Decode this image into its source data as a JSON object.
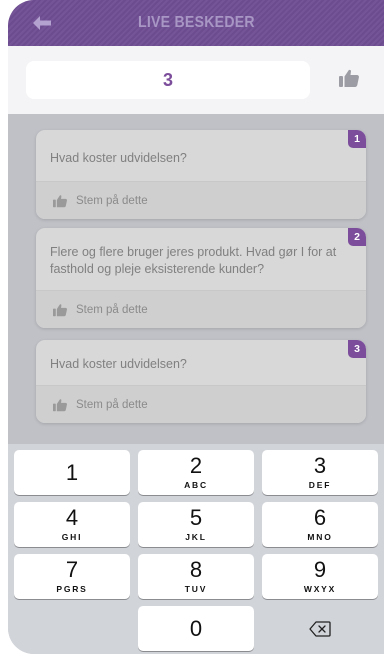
{
  "header": {
    "title": "LIVE BESKEDER",
    "back_icon": "arrow-left-icon"
  },
  "input": {
    "value": "3",
    "like_icon": "thumbs-up-icon"
  },
  "messages": [
    {
      "number": "1",
      "text": "Hvad koster udvidelsen?",
      "vote_label": "Stem på dette"
    },
    {
      "number": "2",
      "text": "Flere og flere bruger jeres produkt. Hvad gør I for at fasthold og pleje eksisterende kunder?",
      "vote_label": "Stem på dette"
    },
    {
      "number": "3",
      "text": "Hvad koster udvidelsen?",
      "vote_label": "Stem på dette"
    }
  ],
  "keypad": {
    "keys": [
      {
        "digit": "1",
        "letters": ""
      },
      {
        "digit": "2",
        "letters": "ABC"
      },
      {
        "digit": "3",
        "letters": "DEF"
      },
      {
        "digit": "4",
        "letters": "GHI"
      },
      {
        "digit": "5",
        "letters": "JKL"
      },
      {
        "digit": "6",
        "letters": "MNO"
      },
      {
        "digit": "7",
        "letters": "PGRS"
      },
      {
        "digit": "8",
        "letters": "TUV"
      },
      {
        "digit": "9",
        "letters": "WXYX"
      },
      {
        "digit": "0",
        "letters": ""
      }
    ],
    "delete_icon": "backspace-icon"
  },
  "colors": {
    "header_bg": "#6f4d93",
    "accent": "#7b4d9b",
    "header_title": "#a896c4"
  }
}
